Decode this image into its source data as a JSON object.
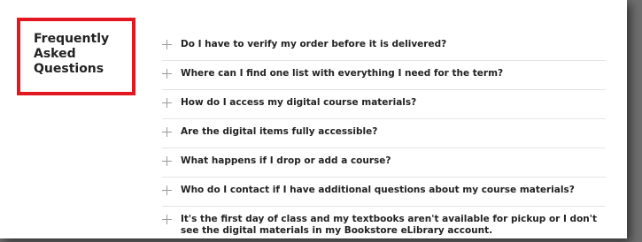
{
  "sidebar": {
    "heading": "Frequently Asked Questions"
  },
  "faq": {
    "items": [
      {
        "question": "Do I have to verify my order before it is delivered?"
      },
      {
        "question": "Where can I find one list with everything I need for the term?"
      },
      {
        "question": "How do I access my digital course materials?"
      },
      {
        "question": "Are the digital items fully accessible?"
      },
      {
        "question": "What happens if I drop or add a course?"
      },
      {
        "question": "Who do I contact if I have additional questions about my course materials?"
      },
      {
        "question": "It's the first day of class and my textbooks aren't available for pickup or I don't see the digital materials in my Bookstore eLibrary account."
      }
    ]
  },
  "colors": {
    "highlight": "#e3171f",
    "text": "#222222",
    "icon": "#9a9a9a",
    "divider": "#e4e4e4"
  },
  "icons": {
    "expand": "plus-icon"
  }
}
